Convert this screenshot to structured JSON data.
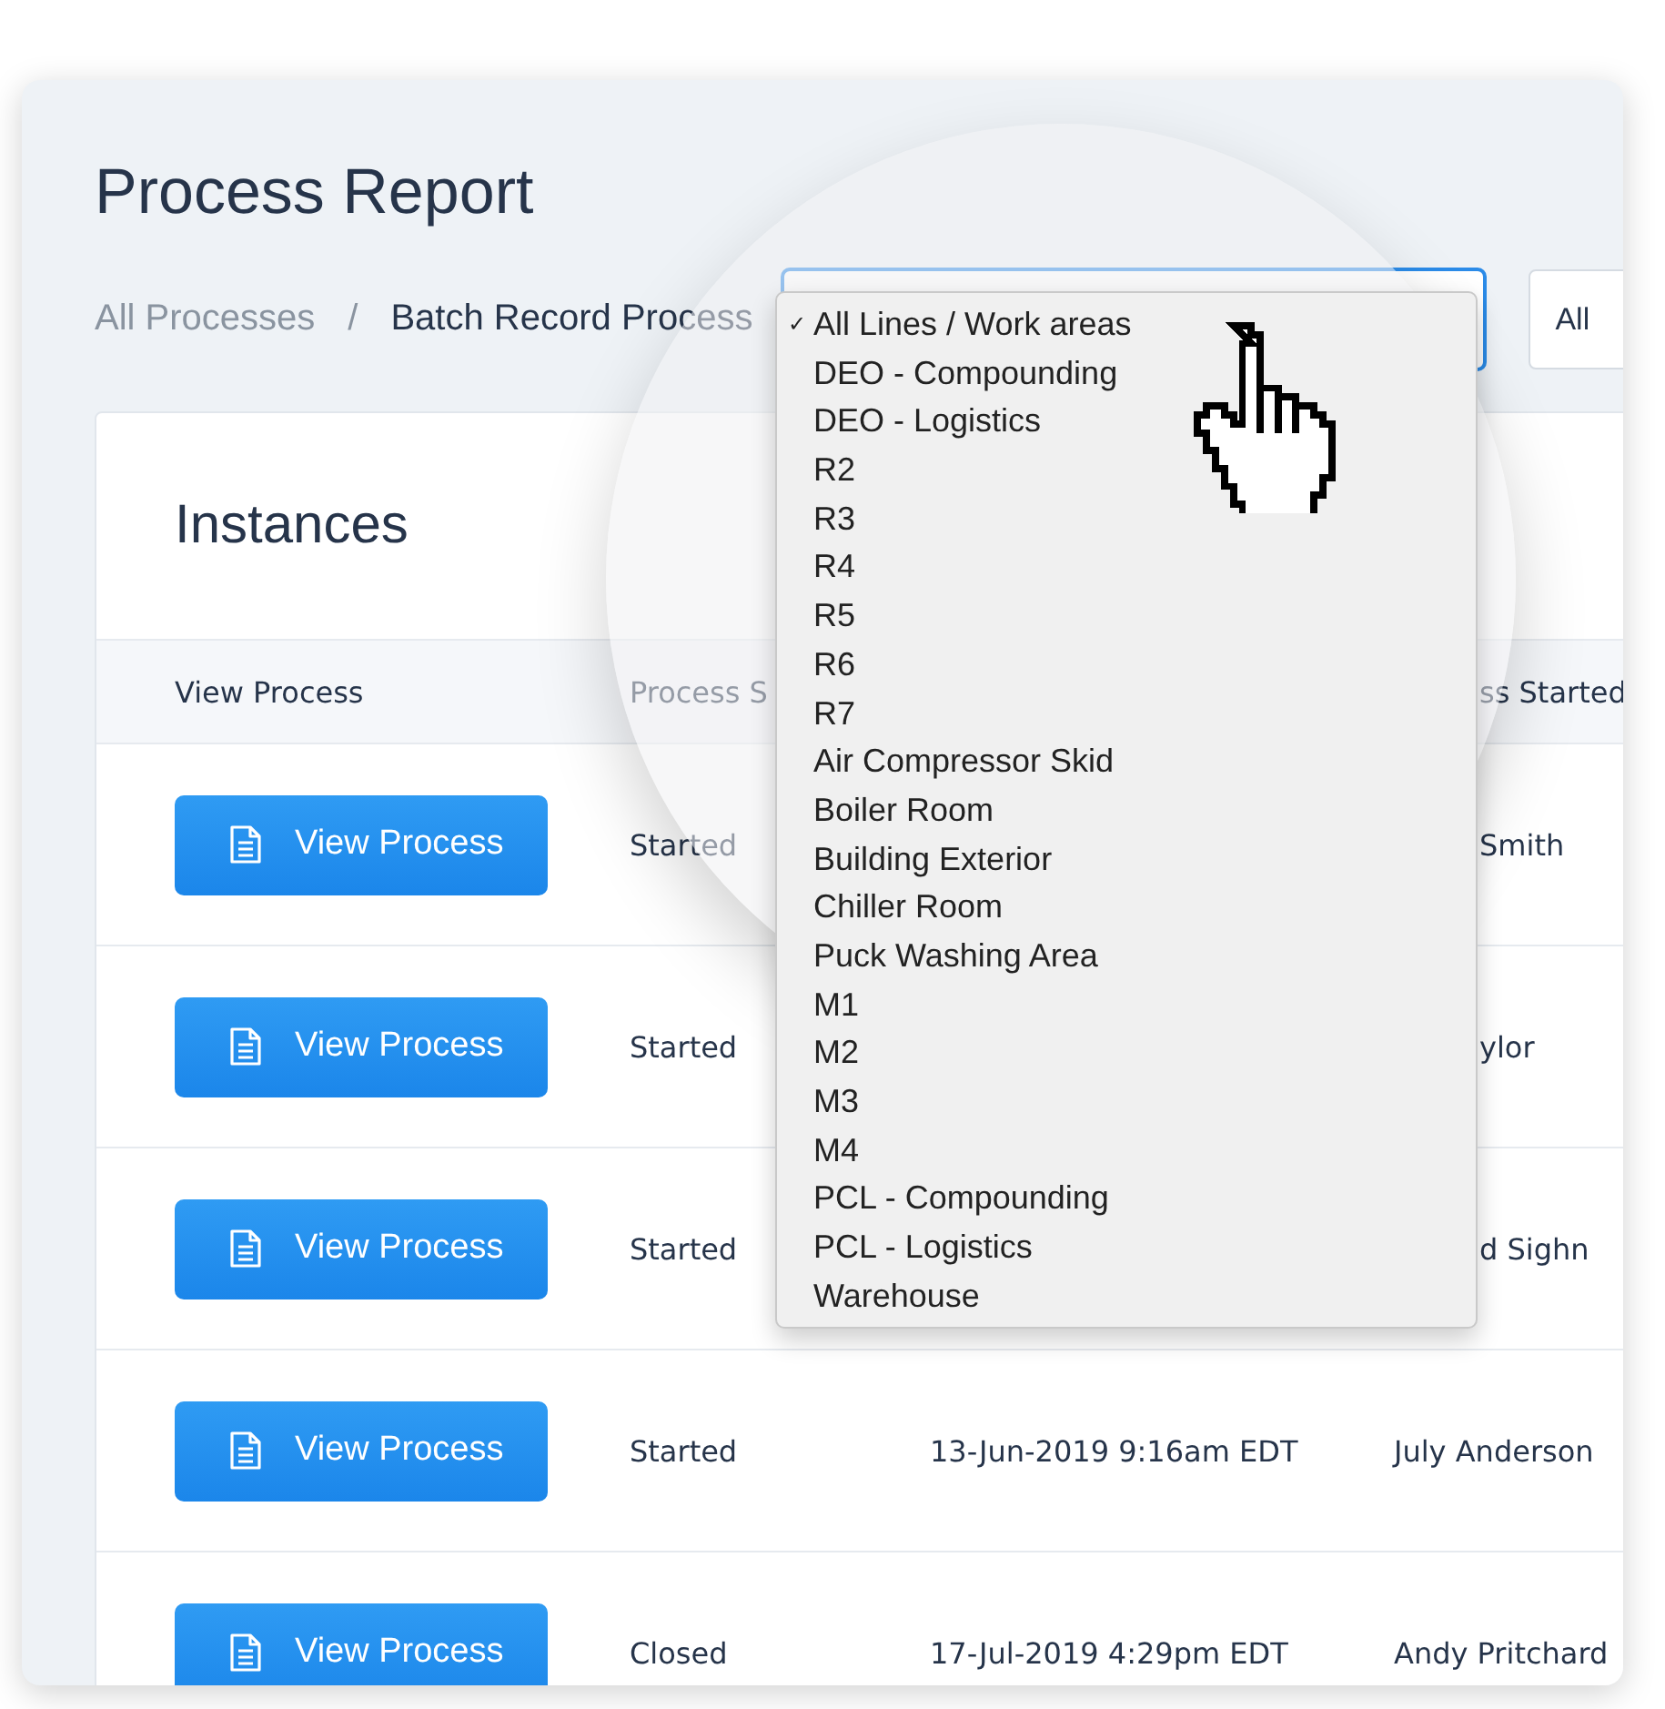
{
  "title": "Process Report",
  "breadcrumb": [
    {
      "label": "All Processes",
      "selected": false
    },
    {
      "label": "Batch Record Process",
      "selected": true
    }
  ],
  "breadcrumb_separator": "/",
  "filters": [
    {
      "kind": "select",
      "focused": true
    },
    {
      "kind": "select",
      "value": "All",
      "focused": false
    }
  ],
  "dropdown": {
    "options": [
      {
        "label": "All Lines / Work areas",
        "selected": true
      },
      {
        "label": "DEO - Compounding",
        "selected": false
      },
      {
        "label": "DEO - Logistics",
        "selected": false
      },
      {
        "label": "R2",
        "selected": false
      },
      {
        "label": "R3",
        "selected": false
      },
      {
        "label": "R4",
        "selected": false
      },
      {
        "label": "R5",
        "selected": false
      },
      {
        "label": "R6",
        "selected": false
      },
      {
        "label": "R7",
        "selected": false
      },
      {
        "label": "Air Compressor Skid",
        "selected": false
      },
      {
        "label": "Boiler Room",
        "selected": false
      },
      {
        "label": "Building Exterior",
        "selected": false
      },
      {
        "label": "Chiller Room",
        "selected": false
      },
      {
        "label": "Puck Washing Area",
        "selected": false
      },
      {
        "label": "M1",
        "selected": false
      },
      {
        "label": "M2",
        "selected": false
      },
      {
        "label": "M3",
        "selected": false
      },
      {
        "label": "M4",
        "selected": false
      },
      {
        "label": "PCL - Compounding",
        "selected": false
      },
      {
        "label": "PCL - Logistics",
        "selected": false
      },
      {
        "label": "Warehouse",
        "selected": false
      }
    ],
    "check": "✓"
  },
  "instances": {
    "title": "Instances",
    "columns": [
      "View Process",
      "Process S",
      "ss Started"
    ],
    "rows": [
      {
        "button": "View Process",
        "status": "Started",
        "name": "Smith"
      },
      {
        "button": "View Process",
        "status": "Started",
        "name": "ylor"
      },
      {
        "button": "View Process",
        "status": "Started",
        "name": "d Sighn"
      },
      {
        "button": "View Process",
        "status": "Started",
        "date": "13-Jun-2019 9:16am EDT",
        "name": "July Anderson"
      },
      {
        "button": "View Process",
        "status": "Closed",
        "date": "17-Jul-2019 4:29pm EDT",
        "name": "Andy Pritchard"
      }
    ]
  }
}
